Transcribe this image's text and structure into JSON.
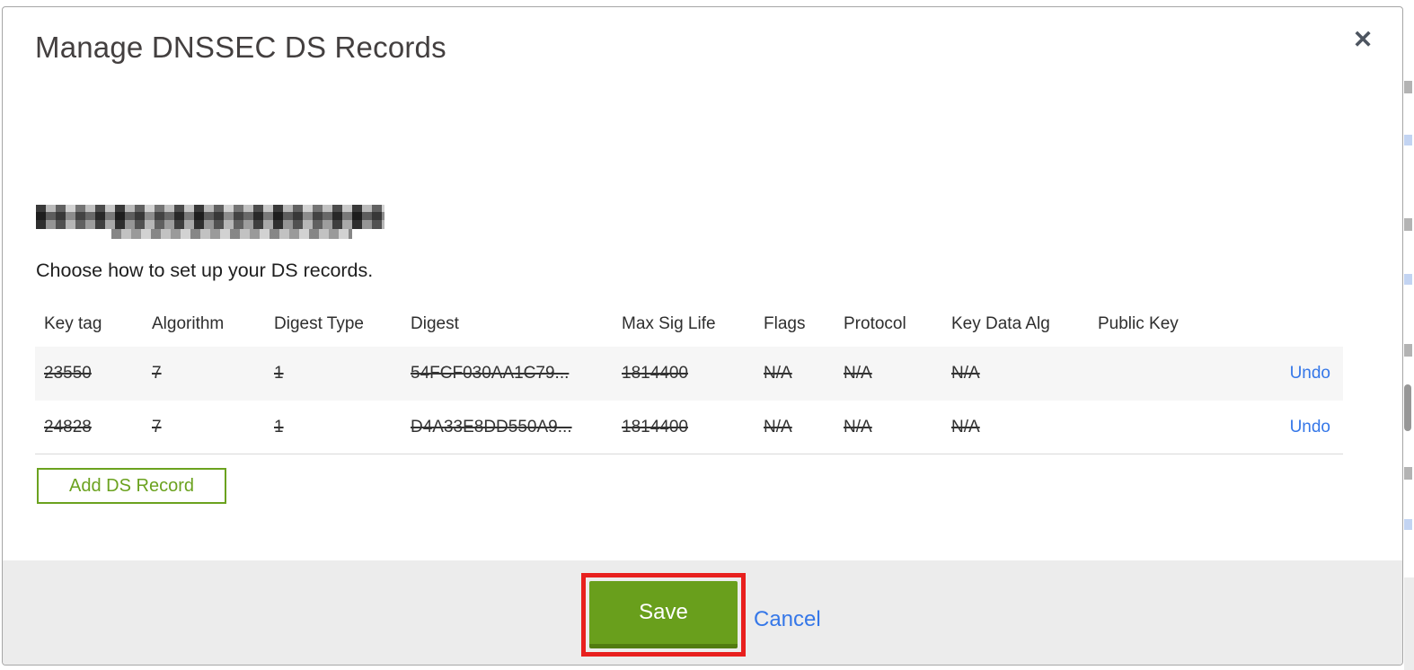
{
  "modal": {
    "title": "Manage DNSSEC DS Records",
    "close_icon": "✕"
  },
  "domain": {
    "redacted": true
  },
  "instruction": "Choose how to set up your DS records.",
  "table": {
    "columns": [
      "Key tag",
      "Algorithm",
      "Digest Type",
      "Digest",
      "Max Sig Life",
      "Flags",
      "Protocol",
      "Key Data Alg",
      "Public Key"
    ],
    "rows": [
      {
        "key_tag": "23550",
        "algorithm": "7",
        "digest_type": "1",
        "digest": "54FCF030AA1C79...",
        "max_sig_life": "1814400",
        "flags": "N/A",
        "protocol": "N/A",
        "key_data_alg": "N/A",
        "public_key": "",
        "action": "Undo",
        "struck": true
      },
      {
        "key_tag": "24828",
        "algorithm": "7",
        "digest_type": "1",
        "digest": "D4A33E8DD550A9...",
        "max_sig_life": "1814400",
        "flags": "N/A",
        "protocol": "N/A",
        "key_data_alg": "N/A",
        "public_key": "",
        "action": "Undo",
        "struck": true
      }
    ]
  },
  "buttons": {
    "add_record": "Add DS Record",
    "save": "Save",
    "cancel": "Cancel"
  },
  "colors": {
    "button_green": "#699f1c",
    "button_green_dark_edge": "#517c10",
    "outline_button_green": "#6ba21f",
    "link_blue": "#3577e8",
    "annotation_red": "#e8201e",
    "footer_gray": "#ececec",
    "row_alt_gray": "#f6f6f6",
    "title_gray": "#433f3f"
  }
}
